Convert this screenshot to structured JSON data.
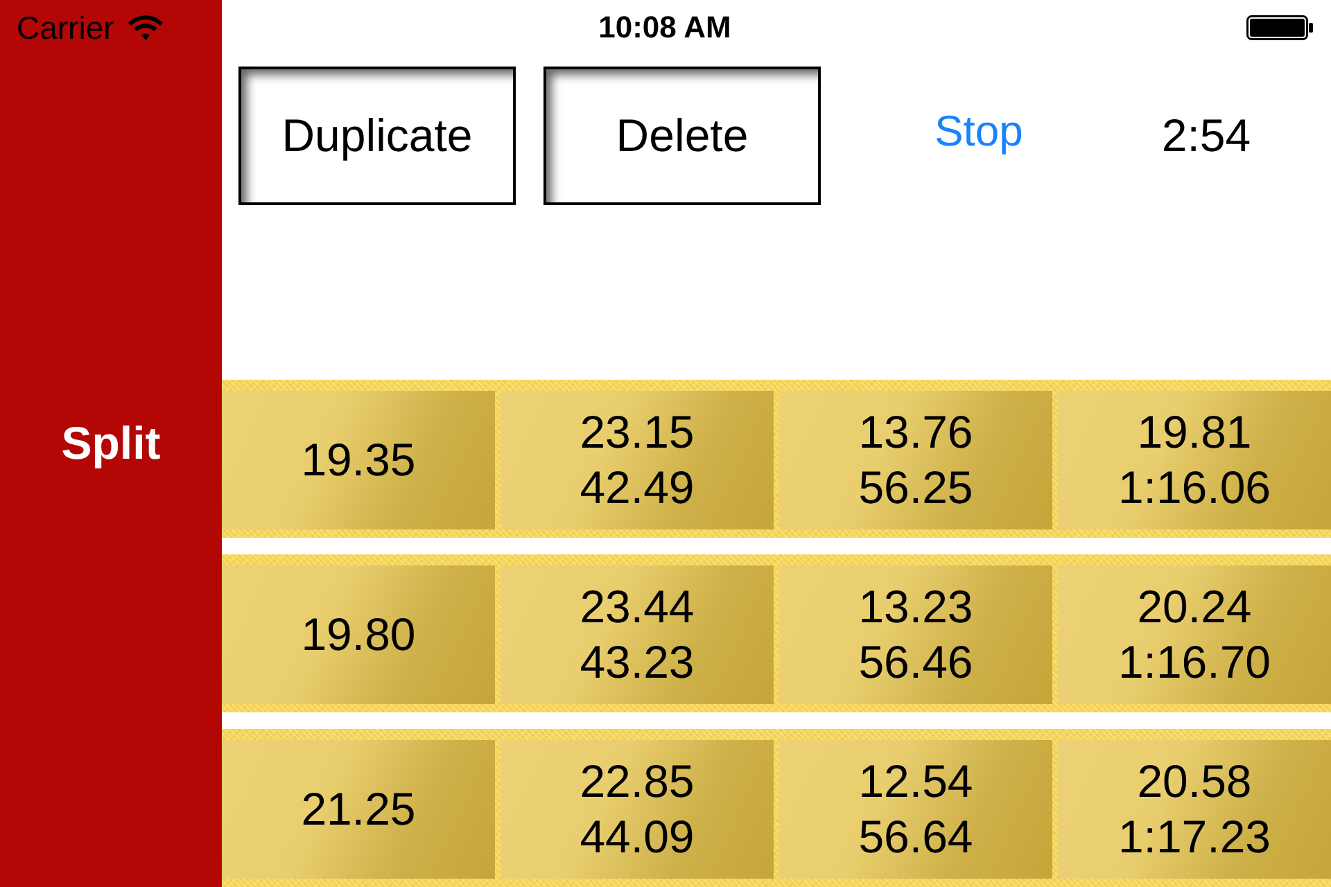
{
  "status_bar": {
    "carrier": "Carrier",
    "time": "10:08 AM"
  },
  "sidebar": {
    "label": "Split"
  },
  "toolbar": {
    "buttons": [
      {
        "label": "Duplicate"
      },
      {
        "label": "Delete"
      }
    ],
    "stop": "Stop",
    "timer": "2:54"
  },
  "splits": [
    {
      "cells": [
        {
          "lap": "19.35"
        },
        {
          "lap": "23.15",
          "total": "42.49"
        },
        {
          "lap": "13.76",
          "total": "56.25"
        },
        {
          "lap": "19.81",
          "total": "1:16.06"
        }
      ]
    },
    {
      "cells": [
        {
          "lap": "19.80"
        },
        {
          "lap": "23.44",
          "total": "43.23"
        },
        {
          "lap": "13.23",
          "total": "56.46"
        },
        {
          "lap": "20.24",
          "total": "1:16.70"
        }
      ]
    },
    {
      "cells": [
        {
          "lap": "21.25"
        },
        {
          "lap": "22.85",
          "total": "44.09"
        },
        {
          "lap": "12.54",
          "total": "56.64"
        },
        {
          "lap": "20.58",
          "total": "1:17.23"
        }
      ]
    }
  ]
}
